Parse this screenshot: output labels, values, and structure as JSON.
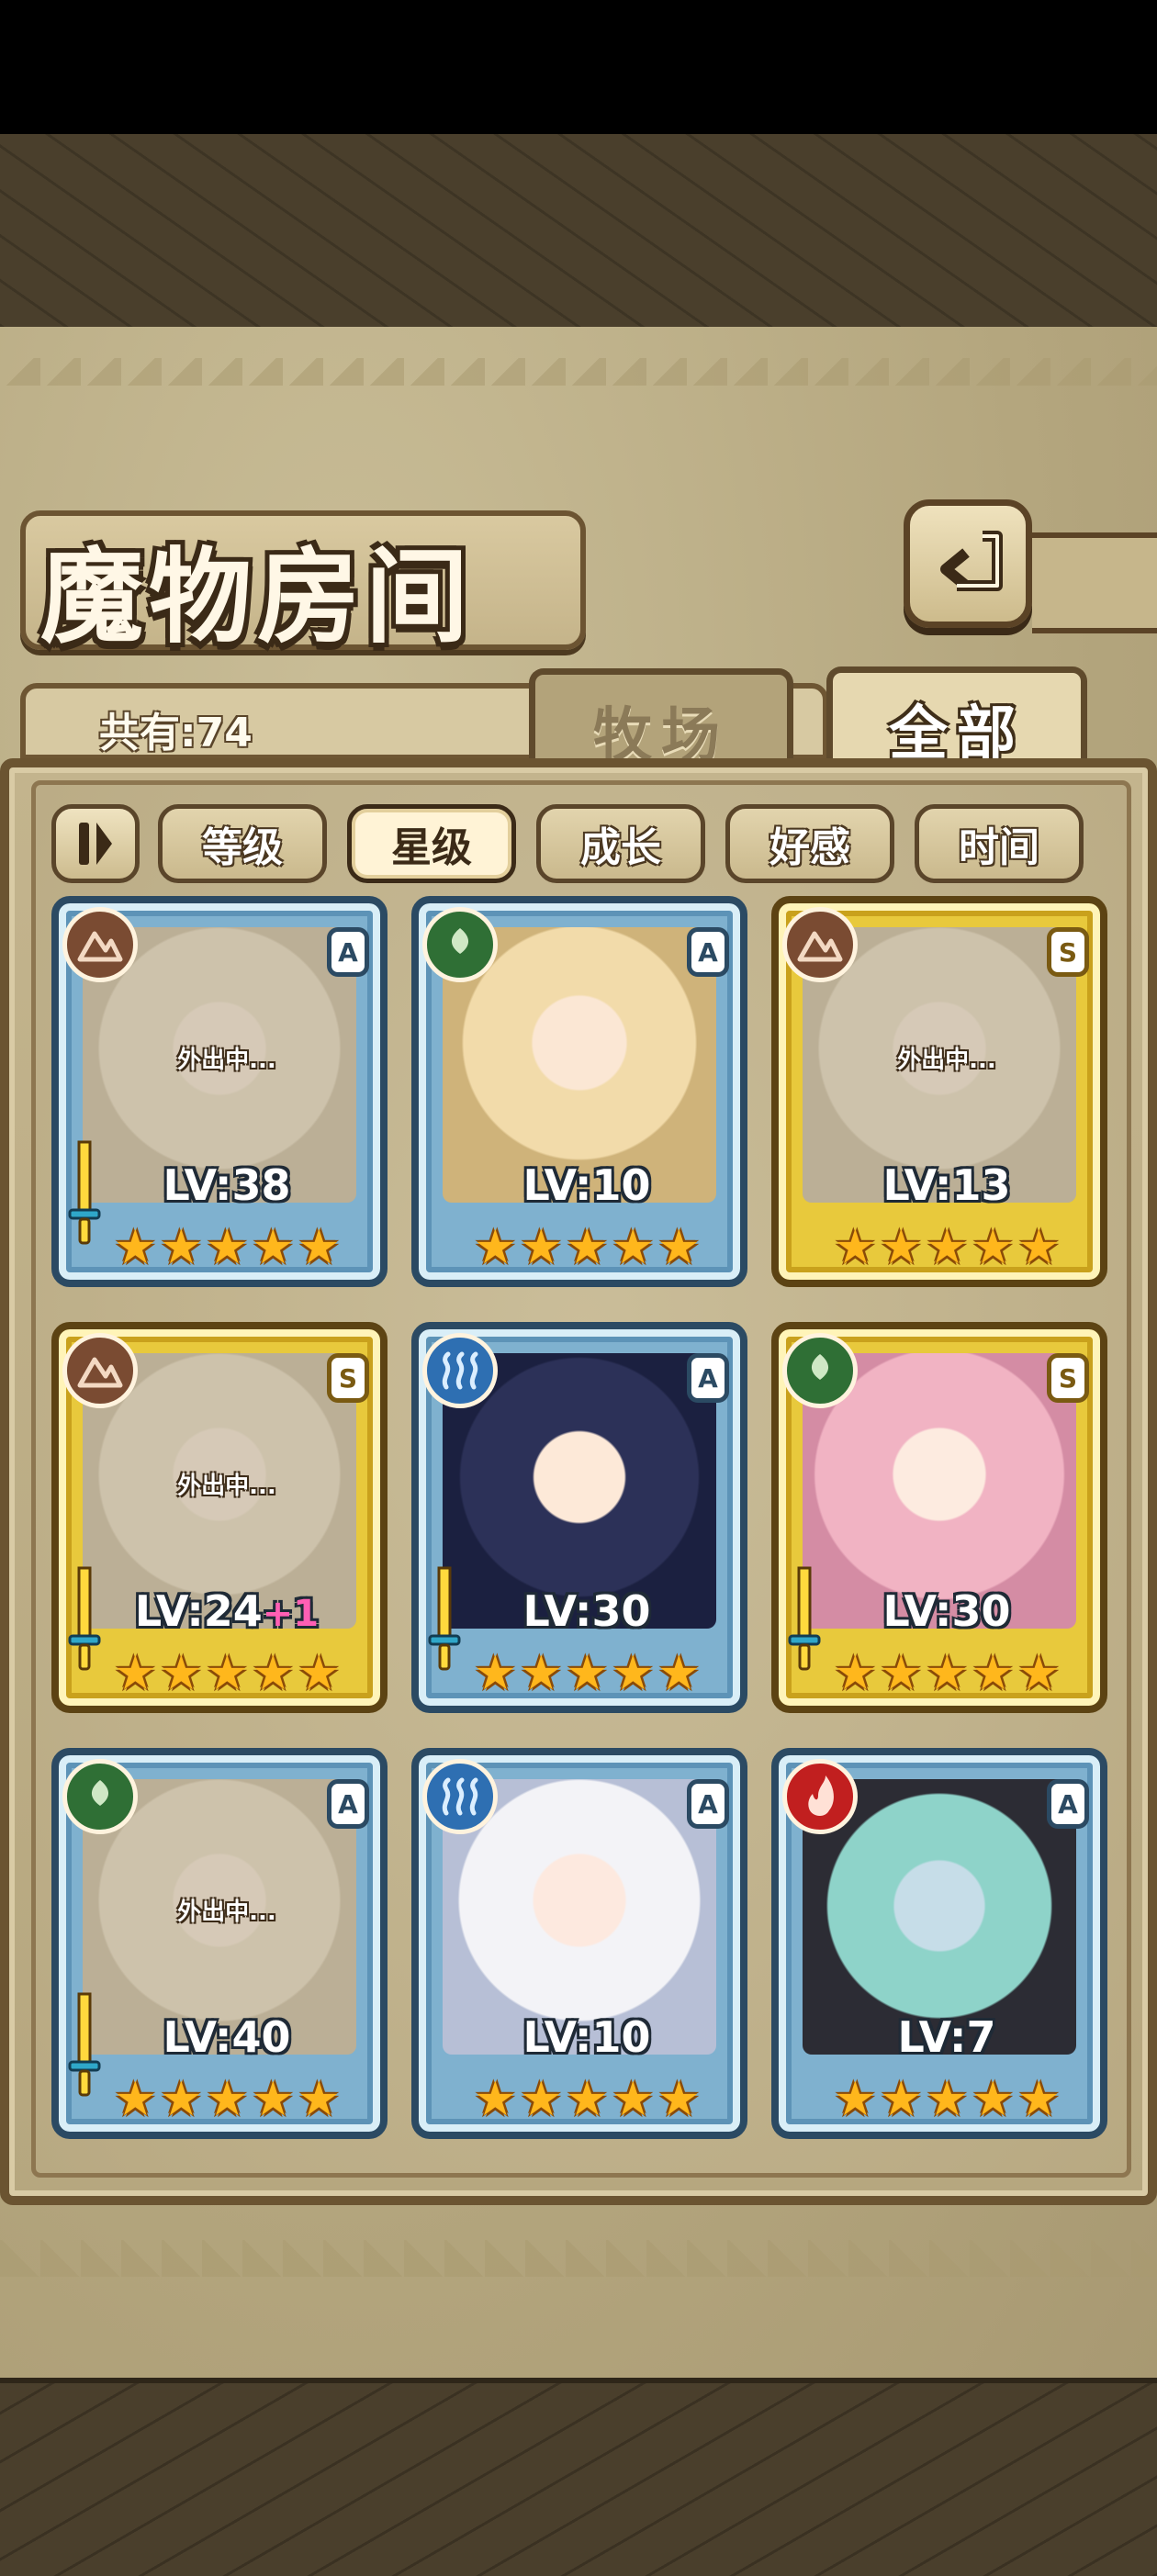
{
  "header": {
    "title": "魔物房间"
  },
  "summary": {
    "count_text": "共有:74"
  },
  "tabs": [
    {
      "label": "牧场",
      "selected": false
    },
    {
      "label": "全部",
      "selected": true
    }
  ],
  "filters": [
    {
      "label": "等级",
      "selected": false
    },
    {
      "label": "星级",
      "selected": true
    },
    {
      "label": "成长",
      "selected": false
    },
    {
      "label": "好感",
      "selected": false
    },
    {
      "label": "时间",
      "selected": false
    }
  ],
  "monsters": [
    {
      "element": "earth-icon",
      "rank": "A",
      "frame": "blue",
      "hair": "cream",
      "status": "外出中...",
      "level": "LV:38",
      "level_bonus": "",
      "stars": 5,
      "weapon": true
    },
    {
      "element": "wood-icon",
      "rank": "A",
      "frame": "blue",
      "hair": "blond",
      "status": "",
      "level": "LV:10",
      "level_bonus": "",
      "stars": 5,
      "weapon": false
    },
    {
      "element": "earth-icon",
      "rank": "S",
      "frame": "gold",
      "hair": "cream",
      "status": "外出中...",
      "level": "LV:13",
      "level_bonus": "",
      "stars": 5,
      "weapon": false
    },
    {
      "element": "earth-icon",
      "rank": "S",
      "frame": "gold",
      "hair": "cream",
      "status": "外出中...",
      "level": "LV:24",
      "level_bonus": "+1",
      "stars": 5,
      "weapon": true
    },
    {
      "element": "water-icon",
      "rank": "A",
      "frame": "blue",
      "hair": "navy",
      "status": "",
      "level": "LV:30",
      "level_bonus": "",
      "stars": 5,
      "weapon": true
    },
    {
      "element": "wood-icon",
      "rank": "S",
      "frame": "gold",
      "hair": "pink",
      "status": "",
      "level": "LV:30",
      "level_bonus": "",
      "stars": 5,
      "weapon": true
    },
    {
      "element": "wood-icon",
      "rank": "A",
      "frame": "blue",
      "hair": "cream",
      "status": "外出中...",
      "level": "LV:40",
      "level_bonus": "",
      "stars": 5,
      "weapon": true
    },
    {
      "element": "water-icon",
      "rank": "A",
      "frame": "blue",
      "hair": "white",
      "status": "",
      "level": "LV:10",
      "level_bonus": "",
      "stars": 5,
      "weapon": false
    },
    {
      "element": "fire-icon",
      "rank": "A",
      "frame": "blue",
      "hair": "teal",
      "status": "",
      "level": "LV:7",
      "level_bonus": "",
      "stars": 5,
      "weapon": false
    }
  ],
  "colors": {
    "star": "#ffb71c",
    "frame_blue": "#7fb1cf",
    "frame_gold": "#e8c93c",
    "wood_bg": "#b6a77f"
  }
}
